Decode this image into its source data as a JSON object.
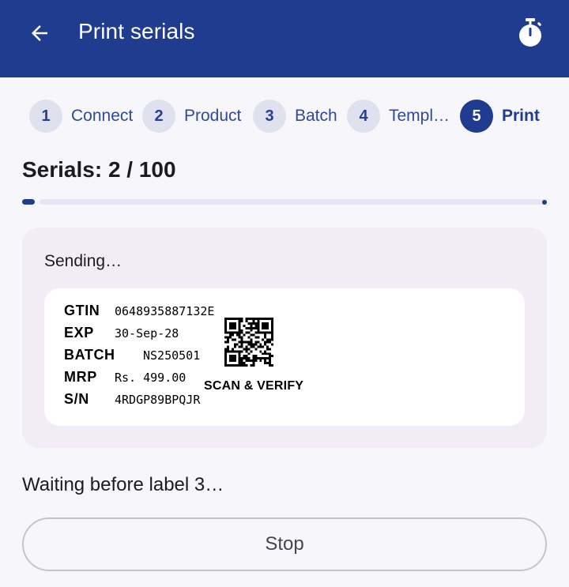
{
  "header": {
    "title": "Print serials",
    "back_icon": "arrow-left-icon",
    "timer_icon": "stopwatch-icon",
    "background": "#1f3c8f"
  },
  "steps": [
    {
      "number": "1",
      "label": "Connect",
      "active": false
    },
    {
      "number": "2",
      "label": "Product",
      "active": false
    },
    {
      "number": "3",
      "label": "Batch",
      "active": false
    },
    {
      "number": "4",
      "label": "Templ…",
      "active": false
    },
    {
      "number": "5",
      "label": "Print",
      "active": true
    }
  ],
  "progress": {
    "text": "Serials: 2 / 100",
    "current": 2,
    "total": 100,
    "accent": "#1f3c8f"
  },
  "card": {
    "status": "Sending…",
    "label": {
      "rows": [
        {
          "key": "GTIN",
          "value": "0648935887132E"
        },
        {
          "key": "EXP",
          "value": "30-Sep-28"
        },
        {
          "key": "BATCH",
          "value": "NS250501"
        },
        {
          "key": "MRP",
          "value": "Rs. 499.00"
        },
        {
          "key": "S/N",
          "value": "4RDGP89BPQJR"
        }
      ],
      "qr_icon": "qr-code-icon",
      "scan_text": "SCAN & VERIFY"
    }
  },
  "waiting_text": "Waiting before label 3…",
  "stop_label": "Stop"
}
